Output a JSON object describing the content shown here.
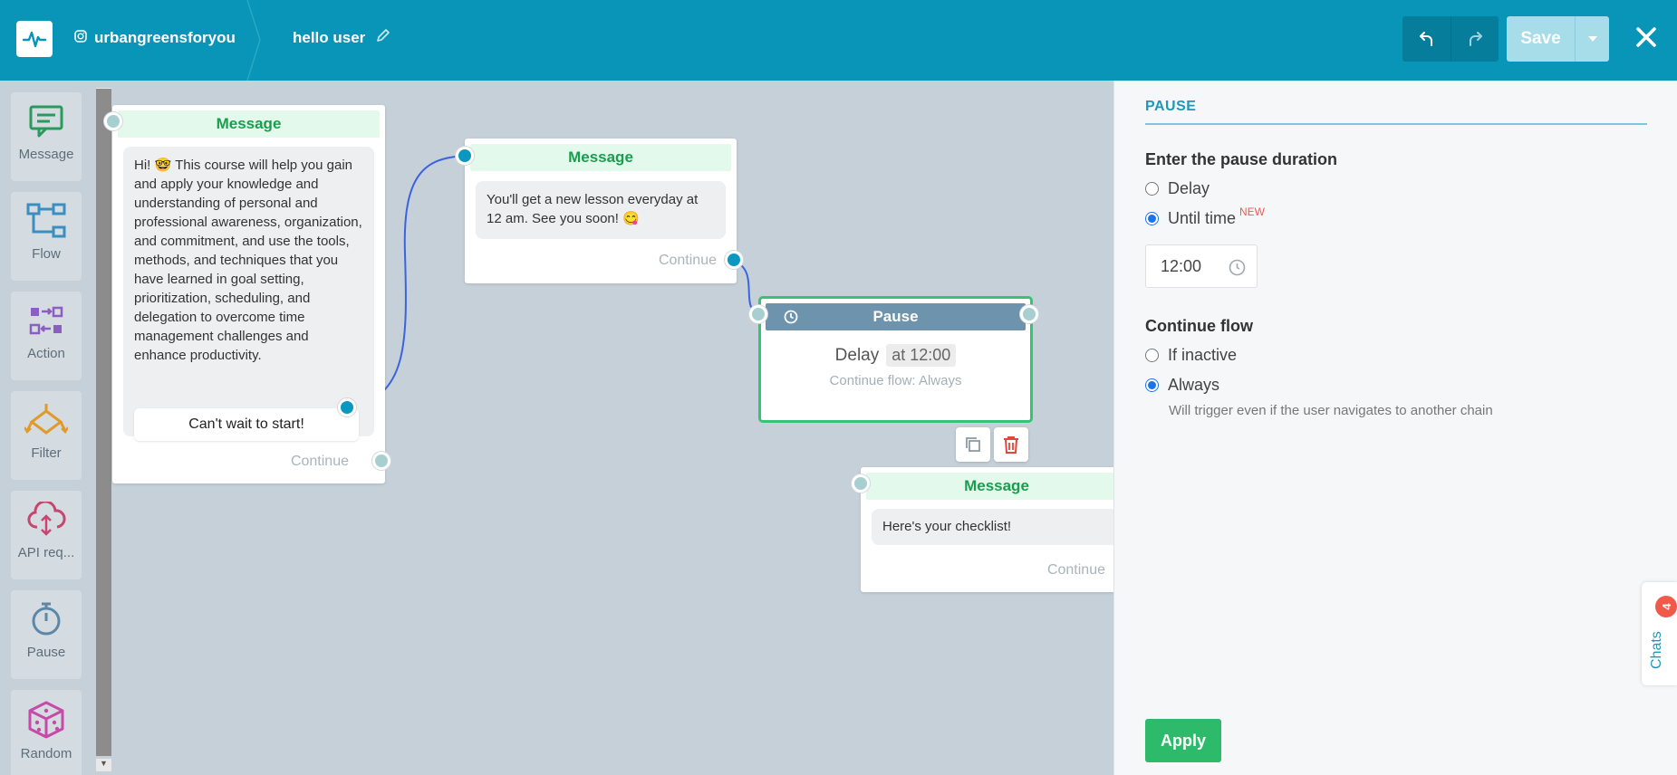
{
  "header": {
    "account_name": "urbangreensforyou",
    "flow_name": "hello user",
    "save_label": "Save",
    "icons": [
      "pulse-logo-icon",
      "instagram-icon",
      "pencil-icon",
      "undo-icon",
      "redo-icon",
      "caret-down-icon",
      "close-icon"
    ]
  },
  "palette": {
    "items": [
      {
        "label": "Message",
        "icon": "message-icon",
        "color": "#2a9a5c"
      },
      {
        "label": "Flow",
        "icon": "flow-icon",
        "color": "#3a8fc0"
      },
      {
        "label": "Action",
        "icon": "action-icon",
        "color": "#8a5fc0"
      },
      {
        "label": "Filter",
        "icon": "filter-icon",
        "color": "#e09a2a"
      },
      {
        "label": "API req...",
        "icon": "api-icon",
        "color": "#c8466e"
      },
      {
        "label": "Pause",
        "icon": "pause-icon",
        "color": "#5d87a6"
      },
      {
        "label": "Random",
        "icon": "dice-icon",
        "color": "#c84aa8"
      }
    ]
  },
  "canvas": {
    "message1": {
      "title": "Message",
      "text": "Hi! 🤓 This course will help you gain and apply your knowledge and understanding of personal and professional awareness, organization, and commitment, and use the tools, methods, and techniques that you have learned in goal setting, prioritization, scheduling, and delegation to overcome time management challenges and enhance productivity.",
      "button": "Can't wait to start!",
      "continue": "Continue"
    },
    "message2": {
      "title": "Message",
      "text": "You'll get a new lesson everyday at 12 am. See you soon! 😋",
      "continue": "Continue"
    },
    "pause": {
      "title": "Pause",
      "delay_label": "Delay",
      "delay_value": "at 12:00",
      "continue_text": "Continue flow: Always"
    },
    "message3": {
      "title": "Message",
      "text": "Here's your checklist!",
      "continue": "Continue"
    }
  },
  "panel": {
    "title": "PAUSE",
    "duration_title": "Enter the pause duration",
    "option_delay": "Delay",
    "option_until": "Until time",
    "new_badge": "NEW",
    "time_value": "12:00",
    "continue_title": "Continue flow",
    "option_inactive": "If inactive",
    "option_always": "Always",
    "always_hint": "Will trigger even if the user navigates to another chain",
    "apply_label": "Apply",
    "selected_duration": "Until time",
    "selected_continue": "Always"
  },
  "chats": {
    "label": "Chats",
    "count": "4"
  },
  "colors": {
    "header": "#0895b8",
    "canvas": "#c5d0d8",
    "accent_green": "#2dba6b",
    "pause_header": "#6e93ad"
  }
}
